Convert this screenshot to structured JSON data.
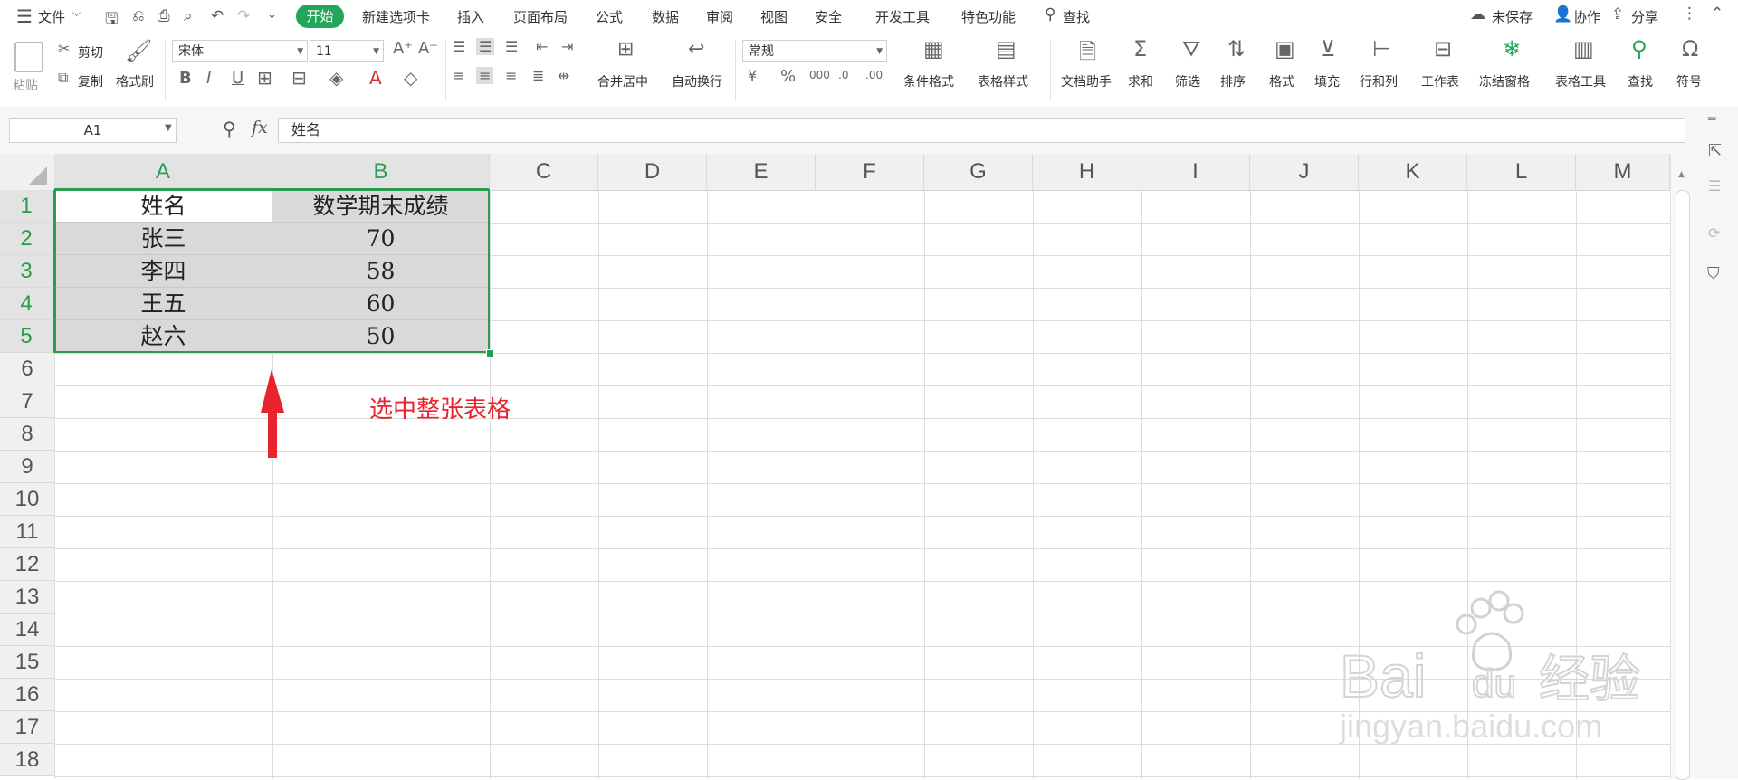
{
  "menubar": {
    "file": "文件",
    "tabs": [
      "开始",
      "新建选项卡",
      "插入",
      "页面布局",
      "公式",
      "数据",
      "审阅",
      "视图",
      "安全",
      "开发工具",
      "特色功能"
    ],
    "search": "查找",
    "right": [
      "未保存",
      "协作",
      "分享"
    ]
  },
  "ribbon": {
    "paste": "粘贴",
    "cut": "剪切",
    "copy": "复制",
    "format_painter": "格式刷",
    "font_name": "宋体",
    "font_size": "11",
    "merge_center": "合并居中",
    "wrap_text": "自动换行",
    "number_format": "常规",
    "buttons": [
      "条件格式",
      "表格样式",
      "文档助手",
      "求和",
      "筛选",
      "排序",
      "格式",
      "填充",
      "行和列",
      "工作表",
      "冻结窗格",
      "表格工具",
      "查找",
      "符号"
    ]
  },
  "formula_bar": {
    "cell_ref": "A1",
    "fx": "fx",
    "value": "姓名"
  },
  "grid": {
    "columns": [
      "A",
      "B",
      "C",
      "D",
      "E",
      "F",
      "G",
      "H",
      "I",
      "J",
      "K",
      "L",
      "M"
    ],
    "rows": [
      "1",
      "2",
      "3",
      "4",
      "5",
      "6",
      "7",
      "8",
      "9",
      "10",
      "11",
      "12",
      "13",
      "14",
      "15",
      "16",
      "17",
      "18"
    ],
    "table": [
      [
        "姓名",
        "数学期末成绩"
      ],
      [
        "张三",
        "70"
      ],
      [
        "李四",
        "58"
      ],
      [
        "王五",
        "60"
      ],
      [
        "赵六",
        "50"
      ]
    ]
  },
  "annotation": {
    "text": "选中整张表格",
    "color": "#e8232b"
  },
  "colors": {
    "accent": "#23a55a",
    "selection_border": "#2a9d4e"
  }
}
